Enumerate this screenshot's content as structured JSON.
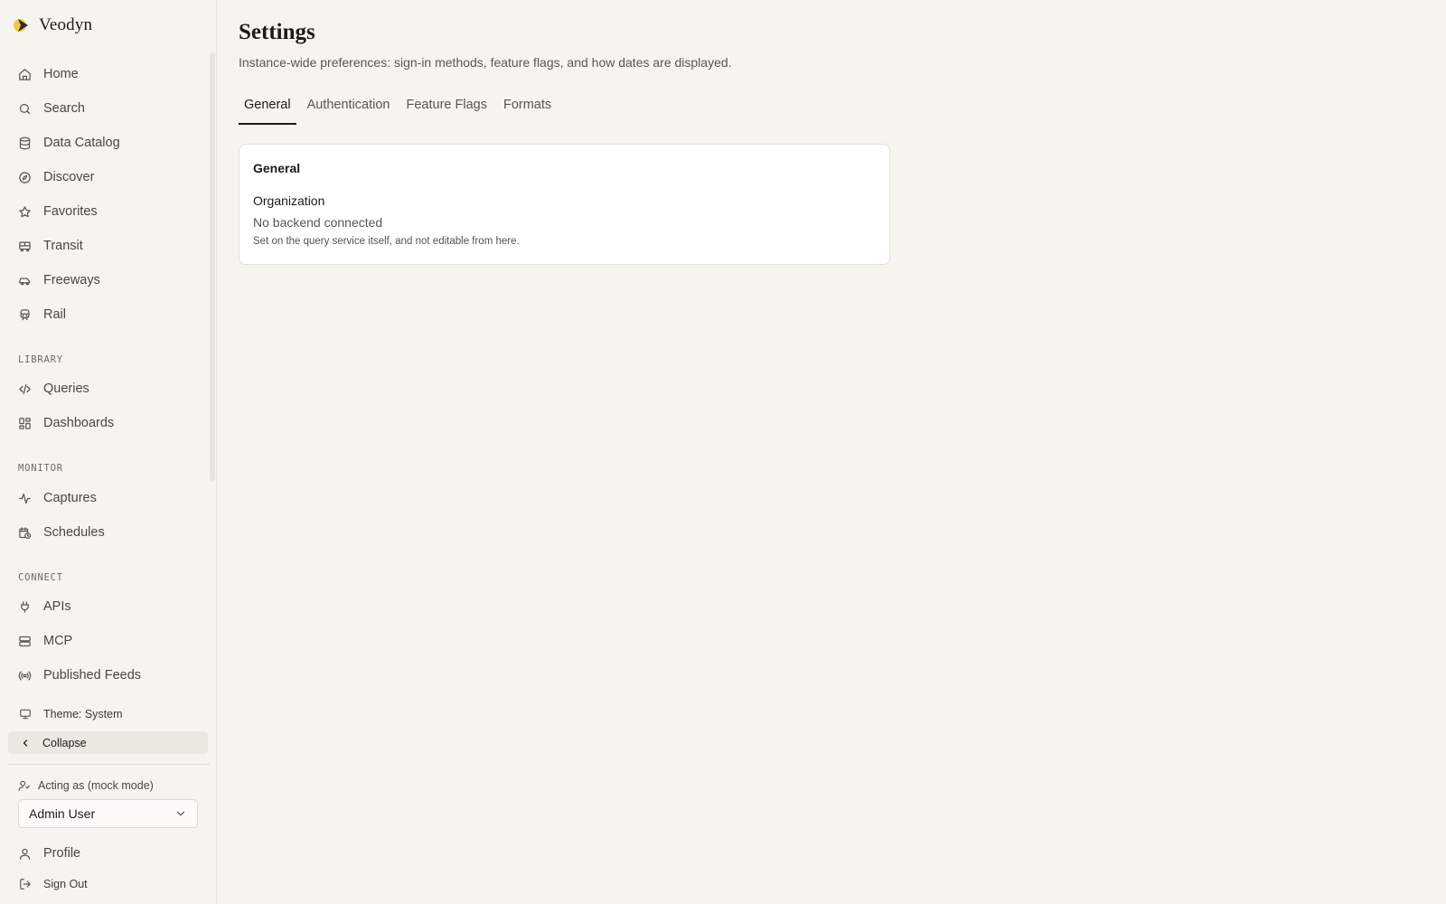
{
  "app": {
    "name": "Veodyn"
  },
  "sidebar": {
    "main_items": [
      {
        "label": "Home",
        "icon": "home-icon"
      },
      {
        "label": "Search",
        "icon": "search-icon"
      },
      {
        "label": "Data Catalog",
        "icon": "database-icon"
      },
      {
        "label": "Discover",
        "icon": "compass-icon"
      },
      {
        "label": "Favorites",
        "icon": "star-icon"
      },
      {
        "label": "Transit",
        "icon": "bus-icon"
      },
      {
        "label": "Freeways",
        "icon": "car-icon"
      },
      {
        "label": "Rail",
        "icon": "train-icon"
      }
    ],
    "library": {
      "label": "LIBRARY",
      "items": [
        {
          "label": "Queries",
          "icon": "code-icon"
        },
        {
          "label": "Dashboards",
          "icon": "dashboard-icon"
        }
      ]
    },
    "monitor": {
      "label": "MONITOR",
      "items": [
        {
          "label": "Captures",
          "icon": "activity-icon"
        },
        {
          "label": "Schedules",
          "icon": "calendar-clock-icon"
        }
      ]
    },
    "connect": {
      "label": "CONNECT",
      "items": [
        {
          "label": "APIs",
          "icon": "plug-icon"
        },
        {
          "label": "MCP",
          "icon": "server-icon"
        },
        {
          "label": "Published Feeds",
          "icon": "broadcast-icon"
        }
      ]
    },
    "theme_label": "Theme: System",
    "collapse_label": "Collapse",
    "acting_label": "Acting as (mock mode)",
    "acting_user": "Admin User",
    "profile_label": "Profile",
    "signout_label": "Sign Out"
  },
  "page": {
    "title": "Settings",
    "subtitle": "Instance-wide preferences: sign-in methods, feature flags, and how dates are displayed.",
    "tabs": [
      {
        "label": "General",
        "active": true
      },
      {
        "label": "Authentication",
        "active": false
      },
      {
        "label": "Feature Flags",
        "active": false
      },
      {
        "label": "Formats",
        "active": false
      }
    ]
  },
  "card": {
    "title": "General",
    "field_label": "Organization",
    "field_value": "No backend connected",
    "field_help": "Set on the query service itself, and not editable from here."
  },
  "colors": {
    "background": "#f6f4ef",
    "card": "#ffffff",
    "text": "#1d1b18",
    "muted": "#5a5650",
    "logo_yellow": "#f2c230",
    "logo_dark": "#2b2a3a"
  }
}
